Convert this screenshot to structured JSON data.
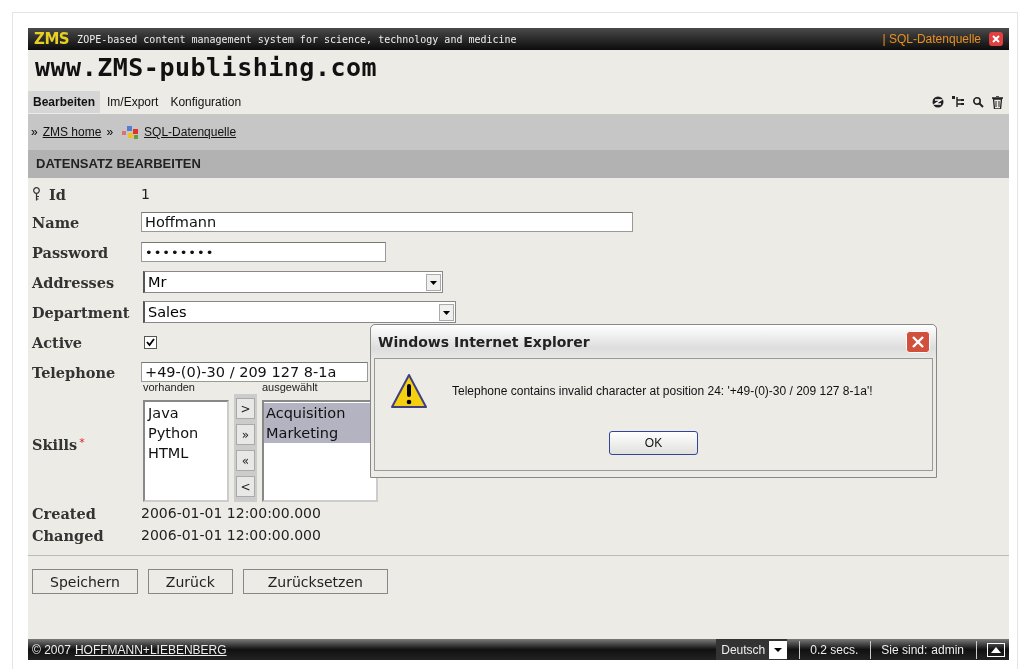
{
  "header": {
    "logo": "ZMS",
    "tagline": "ZOPE-based content management system for science, technology and medicine",
    "context_link": "| SQL-Datenquelle"
  },
  "site_title": "www.ZMS-publishing.com",
  "tabs": [
    {
      "label": "Bearbeiten",
      "selected": true
    },
    {
      "label": "Im/Export",
      "selected": false
    },
    {
      "label": "Konfiguration",
      "selected": false
    }
  ],
  "breadcrumb": [
    {
      "sep": "»",
      "label": "ZMS home"
    },
    {
      "sep": "»",
      "label": "SQL-Datenquelle"
    }
  ],
  "section_title": "DATENSATZ BEARBEITEN",
  "fields": [
    {
      "kind": "key",
      "label": "Id",
      "value": "1"
    },
    {
      "kind": "text",
      "label": "Name",
      "value": "Hoffmann"
    },
    {
      "kind": "password",
      "label": "Password",
      "value": "••••••••"
    },
    {
      "kind": "select",
      "label": "Addresses",
      "value": "Mr"
    },
    {
      "kind": "select",
      "label": "Department",
      "value": "Sales"
    },
    {
      "kind": "checkbox",
      "label": "Active",
      "checked": true
    },
    {
      "kind": "text",
      "label": "Telephone",
      "value": "+49-(0)-30 / 209 127 8-1a"
    },
    {
      "kind": "multiselect",
      "label": "Skills",
      "required_mark": "*",
      "available_label": "vorhanden",
      "selected_label": "ausgewählt",
      "available": [
        "Java",
        "Python",
        "HTML"
      ],
      "chosen": [
        "Acquisition",
        "Marketing"
      ],
      "move_buttons": [
        ">",
        "»",
        "«",
        "<"
      ]
    },
    {
      "kind": "readonly",
      "label": "Created",
      "value": "2006-01-01 12:00:00.000"
    },
    {
      "kind": "readonly",
      "label": "Changed",
      "value": "2006-01-01 12:00:00.000"
    }
  ],
  "buttons": [
    "Speichern",
    "Zurück",
    "Zurücksetzen"
  ],
  "footer": {
    "copyright": "© 2007",
    "company": "HOFFMANN+LIEBENBERG",
    "language": "Deutsch",
    "time": "0.2 secs.",
    "user_label": "Sie sind:",
    "user": "admin"
  },
  "dialog": {
    "title": "Windows Internet Explorer",
    "message": "Telephone contains invalid character at position 24: '+49-(0)-30 / 209 127 8-1a'!",
    "button": "OK"
  }
}
